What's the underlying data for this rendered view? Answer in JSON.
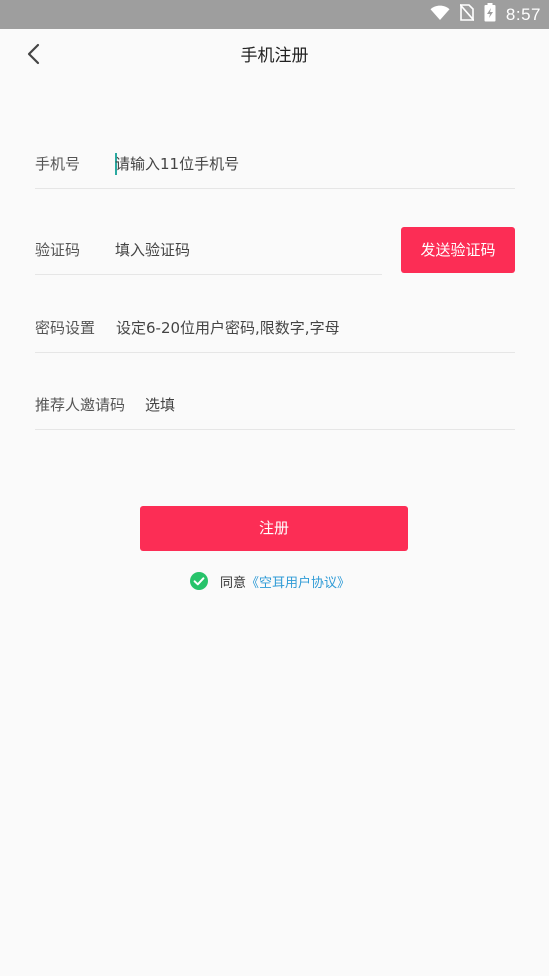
{
  "status_bar": {
    "time": "8:57",
    "icons": [
      "wifi-icon",
      "no-sim-icon",
      "battery-charging-icon"
    ]
  },
  "header": {
    "title": "手机注册",
    "back_icon": "chevron-left-icon"
  },
  "form": {
    "phone": {
      "label": "手机号",
      "placeholder": "请输入11位手机号",
      "value": ""
    },
    "code": {
      "label": "验证码",
      "placeholder": "填入验证码",
      "value": "",
      "send_button": "发送验证码"
    },
    "password": {
      "label": "密码设置",
      "placeholder": "设定6-20位用户密码,限数字,字母",
      "value": ""
    },
    "referral": {
      "label": "推荐人邀请码",
      "placeholder": "选填",
      "value": ""
    }
  },
  "register_button": "注册",
  "agreement": {
    "checked": true,
    "prefix": "同意",
    "link": "《空耳用户协议》",
    "check_color": "#27c36a"
  },
  "colors": {
    "accent": "#fc2d55",
    "link": "#2f9bd6",
    "status_bar": "#9e9e9e"
  }
}
